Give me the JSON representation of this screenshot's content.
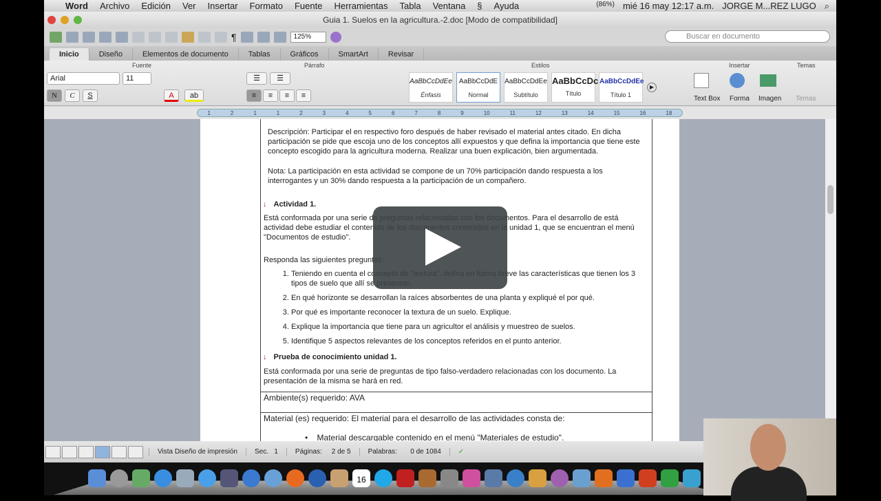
{
  "menubar": {
    "items": [
      "Word",
      "Archivo",
      "Edición",
      "Ver",
      "Insertar",
      "Formato",
      "Fuente",
      "Herramientas",
      "Tabla",
      "Ventana",
      "Ayuda"
    ],
    "battery": "(86%)",
    "datetime": "mié 16 may 12:17 a.m.",
    "user": "JORGE M...REZ LUGO"
  },
  "window": {
    "title": "Guia 1. Suelos en la agricultura.-2.doc [Modo de compatibilidad]"
  },
  "toolbar": {
    "zoom": "125%",
    "search_placeholder": "Buscar en documento"
  },
  "tabs": [
    "Inicio",
    "Diseño",
    "Elementos de documento",
    "Tablas",
    "Gráficos",
    "SmartArt",
    "Revisar"
  ],
  "ribbon": {
    "groups": [
      "Fuente",
      "Párrafo",
      "Estilos",
      "Insertar",
      "Temas"
    ],
    "font": "Arial",
    "size": "11",
    "bold": "N",
    "italic": "C",
    "underline": "S",
    "styles": [
      {
        "sample": "AaBbCcDdEe",
        "name": "Énfasis"
      },
      {
        "sample": "AaBbCcDdE",
        "name": "Normal"
      },
      {
        "sample": "AaBbCcDdEe",
        "name": "Subtítulo"
      },
      {
        "sample": "AaBbCcDc",
        "name": "Título"
      },
      {
        "sample": "AaBbCcDdEe",
        "name": "Título 1"
      }
    ],
    "insert": [
      "Text Box",
      "Forma",
      "Imagen"
    ],
    "themes": "Temas"
  },
  "ruler": [
    "1",
    "2",
    "1",
    "1",
    "2",
    "3",
    "4",
    "5",
    "6",
    "7",
    "8",
    "9",
    "10",
    "11",
    "12",
    "13",
    "14",
    "15",
    "16",
    "18"
  ],
  "document": {
    "descripcion": "Descripción: Participar el en respectivo foro después de haber revisado el material antes citado. En dicha participación se pide que escoja uno de los conceptos allí expuestos y que defina la importancia que tiene este concepto escogido para la agricultura moderna. Realizar una buen explicación, bien argumentada.",
    "nota": "Nota: La participación en esta actividad se compone de un 70% participación dando respuesta a los interrogantes y un 30% dando respuesta a la participación de un compañero.",
    "actividad_title": "Actividad 1.",
    "actividad_text": "Está conformada por una serie de preguntas relacionadas con los documentos. Para el desarrollo de está actividad debe estudiar el contenido de los documentos contenidos en la unidad 1, que se encuentran el menú \"Documentos de estudio\".",
    "responda": "Responda las siguientes preguntas:",
    "questions": [
      "Teniendo en cuenta el concepto de \"textura\", defina en forma breve las características que tienen los 3 tipos de suelo que allí se presentan.",
      "En qué horizonte se desarrollan la raíces absorbentes de una planta y expliqué el por qué.",
      "Por qué es importante reconocer la textura de un suelo. Explique.",
      "Explique la importancia que tiene para un agricultor el análisis y muestreo de suelos.",
      "Identifique 5 aspectos relevantes de los conceptos referidos en el punto anterior."
    ],
    "prueba_title": "Prueba de conocimiento unidad 1.",
    "prueba_text": "Está conformada por una serie de preguntas de tipo falso-verdadero relacionadas con los documento. La presentación de la misma se hará en red.",
    "ambiente": "Ambiente(s) requerido: AVA",
    "material": "Material (es) requerido: El material para el desarrollo de las actividades consta de:",
    "material_item": "Material descargable contenido en el menú \"Materiales de estudio\"."
  },
  "status": {
    "view": "Vista Diseño de impresión",
    "sec_label": "Sec.",
    "sec": "1",
    "pages_label": "Páginas:",
    "pages": "2 de 5",
    "words_label": "Palabras:",
    "words": "0 de 1084"
  },
  "dock": {
    "calendar_day": "16"
  }
}
